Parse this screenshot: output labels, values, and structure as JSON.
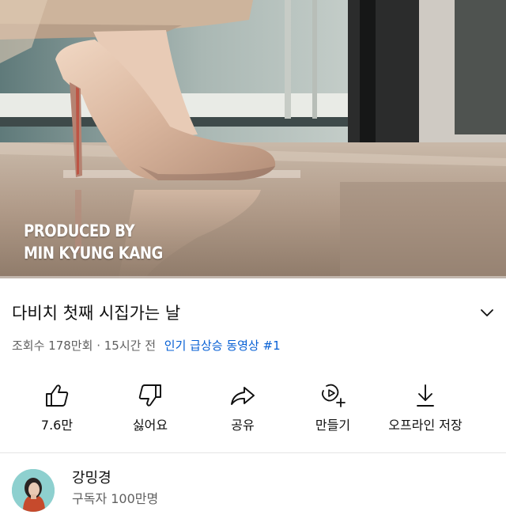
{
  "player": {
    "overlay_line1": "PRODUCED BY",
    "overlay_line2": "MIN KYUNG KANG",
    "progress_fraction": 0.0
  },
  "video": {
    "title": "다비치 첫째 시집가는 날",
    "views": "조회수 178만회",
    "separator": "·",
    "age": "15시간 전",
    "trending": "인기 급상승 동영상 #1"
  },
  "actions": [
    {
      "label": "7.6만",
      "icon": "thumbs-up-icon"
    },
    {
      "label": "싫어요",
      "icon": "thumbs-down-icon"
    },
    {
      "label": "공유",
      "icon": "share-icon"
    },
    {
      "label": "만들기",
      "icon": "create-icon"
    },
    {
      "label": "오프라인 저장",
      "icon": "download-icon"
    }
  ],
  "channel": {
    "name": "강밍경",
    "subscribers": "구독자 100만명"
  },
  "colors": {
    "link": "#065fd4",
    "secondary_text": "#606060",
    "primary_text": "#0f0f0f",
    "progress": "#ff0000"
  }
}
